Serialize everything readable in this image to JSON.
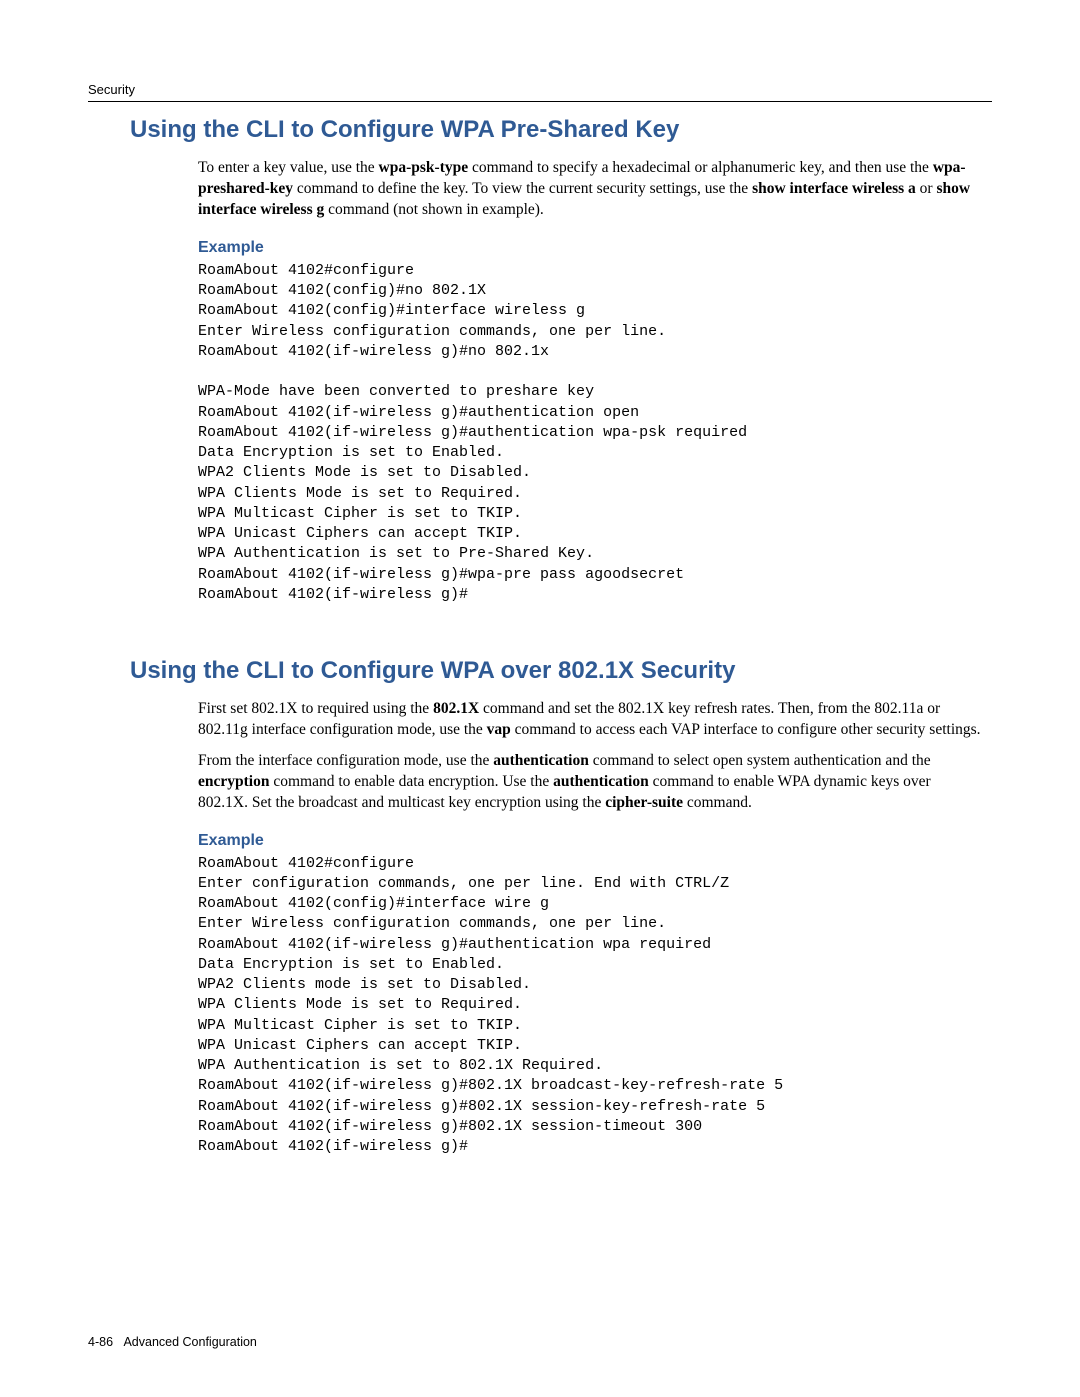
{
  "header": {
    "section": "Security"
  },
  "section1": {
    "title": "Using the CLI to Configure WPA Pre-Shared Key",
    "para1_pre": "To enter a key value, use the ",
    "para1_b1": "wpa-psk-type",
    "para1_mid1": " command to specify a hexadecimal or alphanumeric key, and then use the ",
    "para1_b2": "wpa-preshared-key",
    "para1_mid2": " command to define the key. To view the current security settings, use the ",
    "para1_b3": "show interface wireless a",
    "para1_mid3": " or ",
    "para1_b4": "show interface wireless g",
    "para1_post": " command (not shown in example).",
    "example_label": "Example",
    "code": "RoamAbout 4102#configure\nRoamAbout 4102(config)#no 802.1X\nRoamAbout 4102(config)#interface wireless g\nEnter Wireless configuration commands, one per line.\nRoamAbout 4102(if-wireless g)#no 802.1x\n\nWPA-Mode have been converted to preshare key\nRoamAbout 4102(if-wireless g)#authentication open\nRoamAbout 4102(if-wireless g)#authentication wpa-psk required\nData Encryption is set to Enabled.\nWPA2 Clients Mode is set to Disabled.\nWPA Clients Mode is set to Required.\nWPA Multicast Cipher is set to TKIP.\nWPA Unicast Ciphers can accept TKIP.\nWPA Authentication is set to Pre-Shared Key.\nRoamAbout 4102(if-wireless g)#wpa-pre pass agoodsecret\nRoamAbout 4102(if-wireless g)#"
  },
  "section2": {
    "title": "Using the CLI to Configure WPA over 802.1X Security",
    "para1_pre": "First set 802.1X to required using the ",
    "para1_b1": "802.1X",
    "para1_mid1": " command and set the 802.1X key refresh rates. Then, from the 802.11a or 802.11g interface configuration mode, use the ",
    "para1_b2": "vap",
    "para1_post": " command to access each VAP interface to configure other security settings.",
    "para2_pre": "From the interface configuration mode, use the ",
    "para2_b1": "authentication",
    "para2_mid1": " command to select open system authentication and the ",
    "para2_b2": "encryption",
    "para2_mid2": " command to enable data encryption. Use the ",
    "para2_b3": "authentication",
    "para2_mid3": " command to enable WPA dynamic keys over 802.1X. Set the broadcast and multicast key encryption using the ",
    "para2_b4": "cipher-suite",
    "para2_post": " command.",
    "example_label": "Example",
    "code": "RoamAbout 4102#configure\nEnter configuration commands, one per line. End with CTRL/Z\nRoamAbout 4102(config)#interface wire g\nEnter Wireless configuration commands, one per line.\nRoamAbout 4102(if-wireless g)#authentication wpa required\nData Encryption is set to Enabled.\nWPA2 Clients mode is set to Disabled.\nWPA Clients Mode is set to Required.\nWPA Multicast Cipher is set to TKIP.\nWPA Unicast Ciphers can accept TKIP.\nWPA Authentication is set to 802.1X Required.\nRoamAbout 4102(if-wireless g)#802.1X broadcast-key-refresh-rate 5\nRoamAbout 4102(if-wireless g)#802.1X session-key-refresh-rate 5\nRoamAbout 4102(if-wireless g)#802.1X session-timeout 300\nRoamAbout 4102(if-wireless g)#"
  },
  "footer": {
    "page": "4-86",
    "label": "Advanced Configuration"
  }
}
